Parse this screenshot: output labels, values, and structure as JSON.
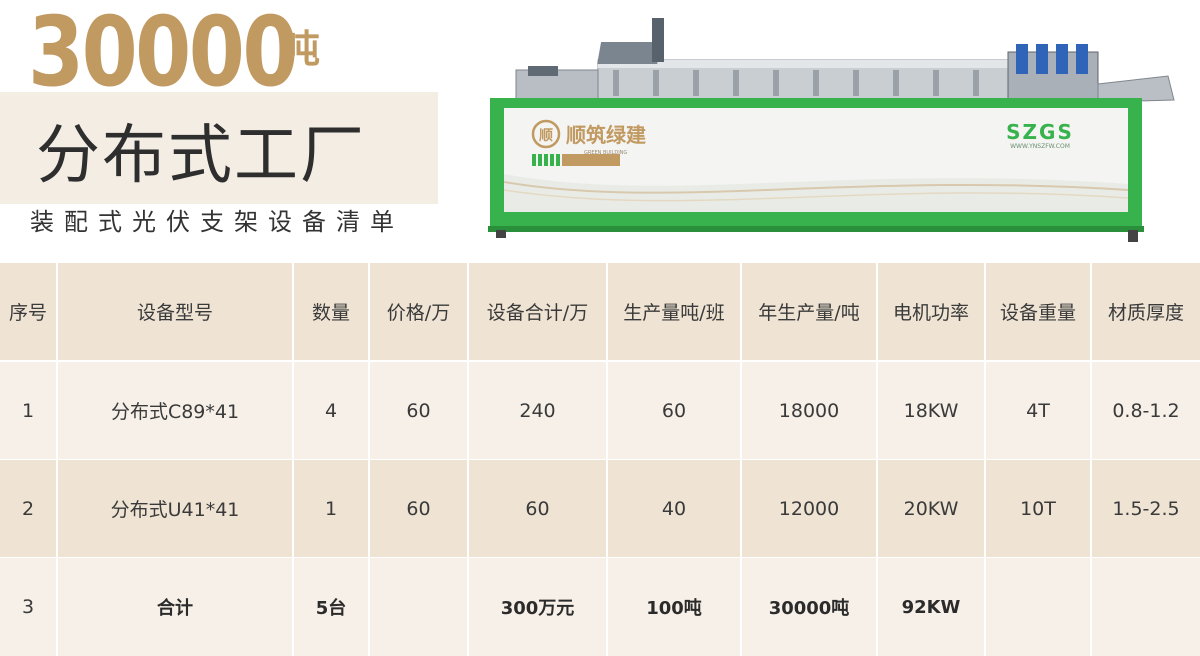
{
  "header": {
    "big_number": "30000",
    "big_unit": "吨",
    "title": "分布式工厂",
    "subtitle": "装配式光伏支架设备清单"
  },
  "machine": {
    "brand_name": "顺筑绿建",
    "brand_sub": "GREEN BUILDING",
    "logo_text": "SZGS",
    "website": "WWW.YNSZFW.COM",
    "colors": {
      "body_green": "#37b24d",
      "panel": "#f4f4f2",
      "accent_gold": "#c19a62"
    }
  },
  "table": {
    "headers": [
      "序号",
      "设备型号",
      "数量",
      "价格/万",
      "设备合计/万",
      "生产量吨/班",
      "年生产量/吨",
      "电机功率",
      "设备重量",
      "材质厚度"
    ],
    "rows": [
      [
        "1",
        "分布式C89*41",
        "4",
        "60",
        "240",
        "60",
        "18000",
        "18KW",
        "4T",
        "0.8-1.2"
      ],
      [
        "2",
        "分布式U41*41",
        "1",
        "60",
        "60",
        "40",
        "12000",
        "20KW",
        "10T",
        "1.5-2.5"
      ],
      [
        "3",
        "合计",
        "5台",
        "",
        "300万元",
        "100吨",
        "30000吨",
        "92KW",
        "",
        ""
      ]
    ]
  },
  "colors": {
    "gold": "#c19a62",
    "header_row": "#efe4d4",
    "light_row": "#f6f0e8"
  }
}
